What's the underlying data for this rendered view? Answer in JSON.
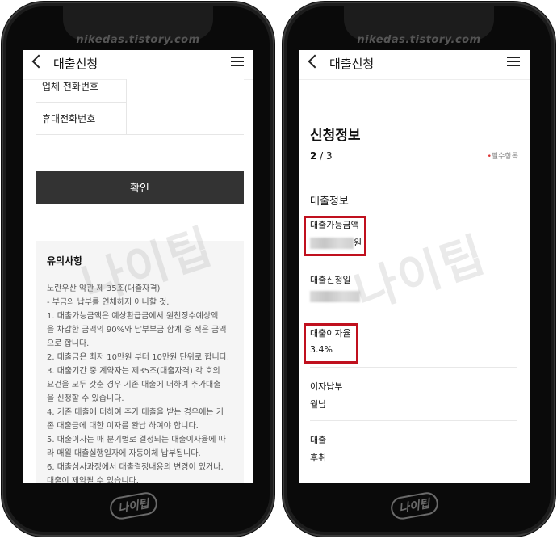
{
  "watermark": {
    "site": "nikedas.tistory.com",
    "brand": "나이팁"
  },
  "left": {
    "header": {
      "title": "대출신청"
    },
    "form": {
      "rows": [
        {
          "label": "업체 전화번호"
        },
        {
          "label": "휴대전화번호"
        }
      ],
      "confirm_label": "확인"
    },
    "notice": {
      "title": "유의사항",
      "lines": [
        "노란우산 약관 제 35조(대출자격)",
        "- 부금의 납부를 연체하지 아니할 것.",
        "1. 대출가능금액은 예상환급금에서 원천징수예상액",
        "을 차감한 금액의 90%와 납부부금 합계 중 적은 금액",
        "으로 합니다.",
        "2. 대출금은 최저 10만원 부터 10만원 단위로 합니다.",
        "3. 대출기간 중 계약자는 제35조(대출자격) 각 호의",
        "요건을 모두 갖춘 경우 기존 대출에 더하여 추가대출",
        "을 신청할 수 있습니다.",
        "4. 기존 대출에 더하여 추가 대출을 받는 경우에는 기",
        "존 대출금에 대한 이자를 완납 하여야 합니다.",
        "5. 대출이자는 매 분기별로 결정되는 대출이자율에 따",
        "라 매월 대출실행일자에 자동이체 납부됩니다.",
        "6. 대출심사과정에서 대출결정내용의 변경이 있거나,",
        "대출이 제약될 수 있습니다."
      ]
    }
  },
  "right": {
    "header": {
      "title": "대출신청"
    },
    "title": "신청정보",
    "step_current": "2",
    "step_sep": " / ",
    "step_total": "3",
    "required_dot": "•",
    "required_label": "필수항목",
    "section_title": "대출정보",
    "fields": {
      "amount_label": "대출가능금액",
      "amount_unit": "원",
      "date_label": "대출신청일",
      "rate_label": "대출이자율",
      "rate_value": "3.4%",
      "interest_label": "이자납부",
      "interest_value": "월납",
      "loan_label": "대출",
      "loan_value": "후취"
    },
    "highlight_color": "#c0101e"
  }
}
